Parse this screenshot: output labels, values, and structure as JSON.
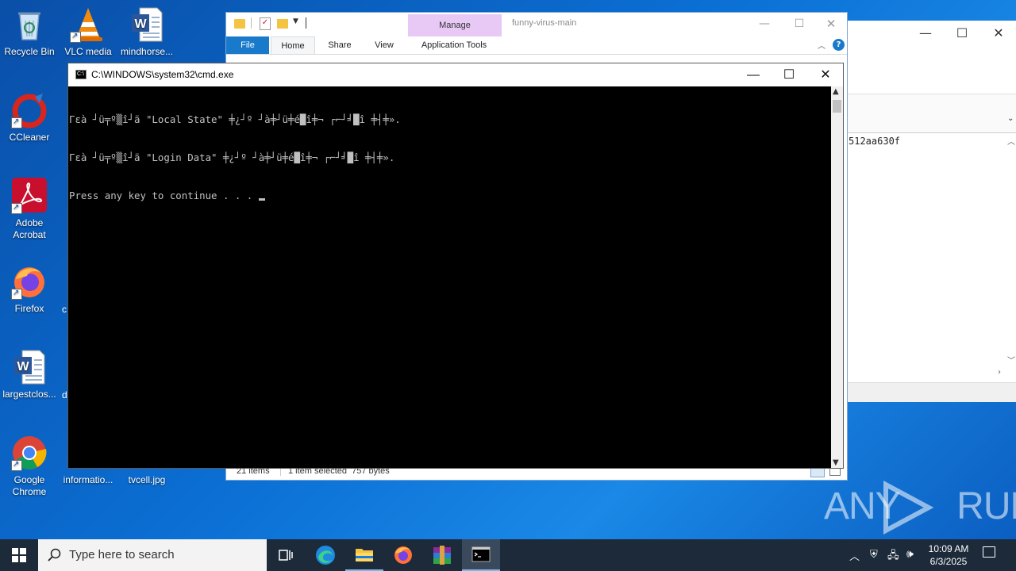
{
  "desktop": {
    "icons": [
      {
        "label": "Recycle Bin"
      },
      {
        "label": "VLC media"
      },
      {
        "label": "mindhorse..."
      },
      {
        "label": "CCleaner"
      },
      {
        "label": "Adobe Acrobat"
      },
      {
        "label": "Firefox"
      },
      {
        "label": "largestclos..."
      },
      {
        "label": "Google Chrome"
      },
      {
        "label": "informatio..."
      },
      {
        "label": "tvcell.jpg"
      }
    ],
    "partial_labels": [
      "c",
      "d"
    ]
  },
  "explorer": {
    "title": "funny-virus-main",
    "context_tab": "Manage",
    "tabs": [
      "File",
      "Home",
      "Share",
      "View",
      "Application Tools"
    ],
    "status_items": "21 items",
    "status_selected": "1 item selected  757 bytes"
  },
  "bg_window": {
    "hash_text": "512aa630f"
  },
  "cmd": {
    "title": "C:\\WINDOWS\\system32\\cmd.exe",
    "lines": [
      "Γεà ┘ü╤º▒î┘ä \"Local State\" ╪¿┘º ┘à╪┘ü╪é█î╪¬ ┌⌐┘╛█î ╪┤╪».",
      "Γεà ┘ü╤º▒î┘ä \"Login Data\" ╪¿┘º ┘à╪┘ü╪é█î╪¬ ┌⌐┘╛█î ╪┤╪».",
      "Press any key to continue . . . "
    ]
  },
  "taskbar": {
    "search_placeholder": "Type here to search",
    "time": "10:09 AM",
    "date": "6/3/2025"
  },
  "watermark": "ANY RUN",
  "colors": {
    "desktop": "#0b6fd4",
    "taskbar": "#1c2a3a",
    "cmd_bg": "#000000",
    "file_tab": "#1979ca",
    "manage_tab": "#e8c8f5"
  }
}
